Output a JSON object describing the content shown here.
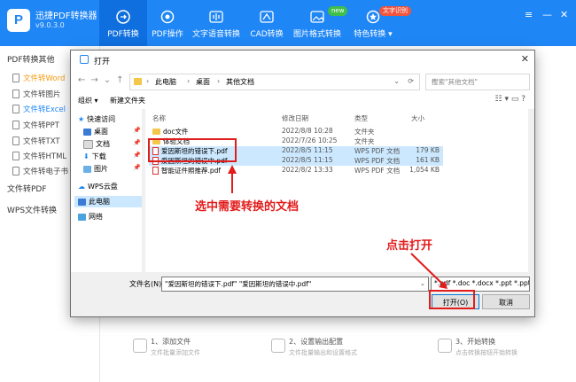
{
  "app": {
    "name": "迅捷PDF转换器",
    "version": "v9.0.3.0",
    "logo_letter": "P"
  },
  "nav_tabs": [
    {
      "label": "PDF转换"
    },
    {
      "label": "PDF操作"
    },
    {
      "label": "文字语音转换"
    },
    {
      "label": "CAD转换"
    },
    {
      "label": "图片格式转换",
      "badge": "new"
    },
    {
      "label": "特色转换",
      "badge": "文字识别"
    }
  ],
  "window_controls": {
    "menu": "≡",
    "minimize": "—",
    "close": "✕"
  },
  "sidebar": {
    "section_pdf_convert_other": "PDF转换其他",
    "items": [
      "文件转Word",
      "文件转图片",
      "文件转Excel",
      "文件转PPT",
      "文件转TXT",
      "文件转HTML",
      "文件转电子书"
    ],
    "section_file_to_pdf": "文件转PDF",
    "section_wps": "WPS文件转换"
  },
  "steps": [
    {
      "num_label": "1、添加文件",
      "desc": "文件批量添加文件"
    },
    {
      "num_label": "2、设置输出配置",
      "desc": "文件批量输出和设置格式"
    },
    {
      "num_label": "3、开始转换",
      "desc": "点击转换按钮开始转换"
    }
  ],
  "dialog": {
    "title": "打开",
    "close": "✕",
    "address": {
      "parts": [
        "此电脑",
        "桌面",
        "其他文档"
      ],
      "sep": "›"
    },
    "search_placeholder": "搜索\"其他文档\"",
    "toolbar": {
      "organize": "组织 ▾",
      "new_folder": "新建文件夹"
    },
    "nav": [
      {
        "label": "快速访问"
      },
      {
        "label": "桌面"
      },
      {
        "label": "文档"
      },
      {
        "label": "下载"
      },
      {
        "label": "图片"
      },
      {
        "label": "WPS云盘"
      },
      {
        "label": "此电脑"
      },
      {
        "label": "网络"
      }
    ],
    "columns": {
      "name": "名称",
      "modified": "修改日期",
      "type": "类型",
      "size": "大小"
    },
    "files": [
      {
        "name": "doc文件",
        "modified": "2022/8/8 10:28",
        "type": "文件夹",
        "size": "",
        "kind": "folder",
        "selected": false
      },
      {
        "name": "体验文档",
        "modified": "2022/7/26 10:25",
        "type": "文件夹",
        "size": "",
        "kind": "folder",
        "selected": false
      },
      {
        "name": "爱因斯坦的错误下.pdf",
        "modified": "2022/8/5 11:15",
        "type": "WPS PDF 文档",
        "size": "179 KB",
        "kind": "pdf",
        "selected": true
      },
      {
        "name": "爱因斯坦的错误中.pdf",
        "modified": "2022/8/5 11:15",
        "type": "WPS PDF 文档",
        "size": "161 KB",
        "kind": "pdf",
        "selected": true
      },
      {
        "name": "智能证件照推荐.pdf",
        "modified": "2022/8/2 13:33",
        "type": "WPS PDF 文档",
        "size": "1,054 KB",
        "kind": "pdf",
        "selected": false
      }
    ],
    "filename_label": "文件名(N):",
    "filename_value": "\"爱因斯坦的错误下.pdf\" \"爱因斯坦的错误中.pdf\"",
    "filetype_value": "*.pdf *.doc *.docx *.ppt *.ppt",
    "open_button": "打开(O)",
    "cancel_button": "取消"
  },
  "annotations": {
    "select_files": "选中需要转换的文档",
    "click_open": "点击打开",
    "color": "#e21b1b"
  }
}
